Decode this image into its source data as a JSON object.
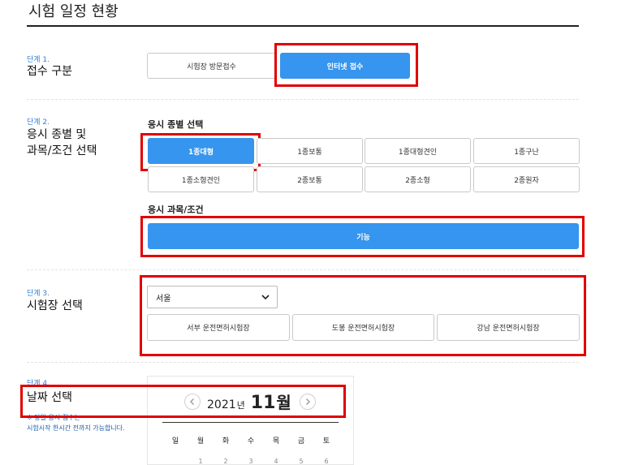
{
  "page": {
    "title": "시험 일정 현황"
  },
  "step1": {
    "no": "단계 1.",
    "title": "접수 구분",
    "options": [
      {
        "label": "시험장 방문접수",
        "active": false
      },
      {
        "label": "인터넷 접수",
        "active": true
      }
    ]
  },
  "step2": {
    "no": "단계 2.",
    "title_line1": "응시 종별 및",
    "title_line2": "과목/조건 선택",
    "type_label": "응시 종별 선택",
    "types": [
      "1종대형",
      "1종보통",
      "1종대형견인",
      "1종구난",
      "1종소형견인",
      "2종보통",
      "2종소형",
      "2종원자"
    ],
    "selected_type": "1종대형",
    "subject_label": "응시 과목/조건",
    "subject_button": "기능"
  },
  "step3": {
    "no": "단계 3.",
    "title": "시험장 선택",
    "region": "서울",
    "centers": [
      "서부 운전면허시험장",
      "도봉 운전면허시험장",
      "강남 운전면허시험장"
    ]
  },
  "step4": {
    "no": "단계 4.",
    "title": "날짜 선택",
    "note1": "※ 당일 응시 접수는",
    "note2": "시험시작 한시간 전까지 가능합니다.",
    "year": "2021",
    "year_suffix": "년",
    "month": "11",
    "month_suffix": "월",
    "weekdays": [
      "일",
      "월",
      "화",
      "수",
      "목",
      "금",
      "토"
    ],
    "partial_days": [
      "1",
      "2",
      "3",
      "4",
      "5",
      "6"
    ]
  }
}
